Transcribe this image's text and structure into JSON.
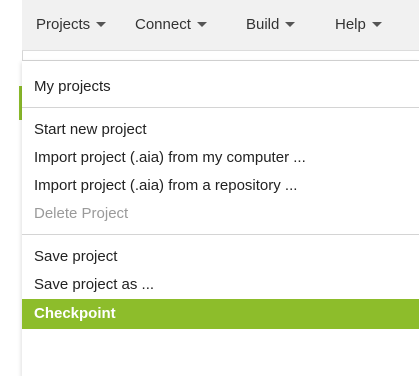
{
  "menubar": {
    "items": [
      {
        "label": "Projects"
      },
      {
        "label": "Connect"
      },
      {
        "label": "Build"
      },
      {
        "label": "Help"
      }
    ]
  },
  "projects_menu": {
    "items": [
      {
        "label": "My projects",
        "enabled": true
      },
      {
        "label": "Start new project",
        "enabled": true
      },
      {
        "label": "Import project (.aia) from my computer ...",
        "enabled": true
      },
      {
        "label": "Import project (.aia) from a repository ...",
        "enabled": true
      },
      {
        "label": "Delete Project",
        "enabled": false
      },
      {
        "label": "Save project",
        "enabled": true
      },
      {
        "label": "Save project as ...",
        "enabled": true
      },
      {
        "label": "Checkpoint",
        "enabled": true,
        "highlighted": true
      }
    ]
  },
  "colors": {
    "accent": "#8dbd2b",
    "menubar_bg": "#f1f1f1",
    "disabled_text": "#9a9a9a"
  },
  "icons": {
    "menu_caret": "caret-down-icon"
  }
}
